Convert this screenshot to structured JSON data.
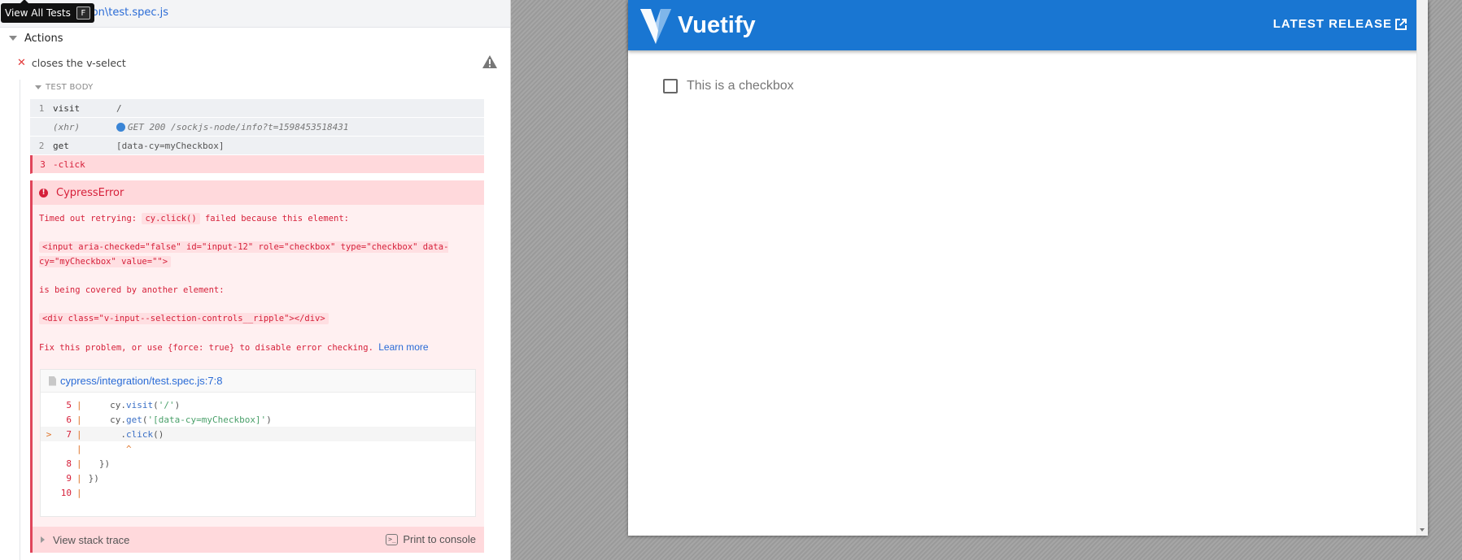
{
  "reporter": {
    "tooltip": {
      "label": "View All Tests",
      "shortcut": "F"
    },
    "spec_path": "tion\\test.spec.js",
    "suite_title": "Actions",
    "test_title": "closes the v-select",
    "test_body_label": "TEST BODY",
    "commands": [
      {
        "num": "1",
        "name": "visit",
        "message": "/"
      },
      {
        "num": "",
        "name": "(xhr)",
        "message": "GET 200 /sockjs-node/info?t=1598453518431"
      },
      {
        "num": "2",
        "name": "get",
        "message": "[data-cy=myCheckbox]"
      },
      {
        "num": "3",
        "name": "-click",
        "message": ""
      }
    ],
    "error": {
      "name": "CypressError",
      "line1_prefix": "Timed out retrying: ",
      "line1_code": "cy.click()",
      "line1_suffix": " failed because this element:",
      "element_html": "<input aria-checked=\"false\" id=\"input-12\" role=\"checkbox\" type=\"checkbox\" data-cy=\"myCheckbox\" value=\"\">",
      "covered_text": "is being covered by another element:",
      "covering_html": "<div class=\"v-input--selection-controls__ripple\"></div>",
      "fix_text": "Fix this problem, or use {force: true} to disable error checking.",
      "learn_more": "Learn more",
      "code_frame_file": "cypress/integration/test.spec.js:7:8",
      "code_lines": [
        {
          "arrow": "",
          "num": "5",
          "code": "cy.visit('/')"
        },
        {
          "arrow": "",
          "num": "6",
          "code": "cy.get('[data-cy=myCheckbox]')"
        },
        {
          "arrow": ">",
          "num": "7",
          "code": ".click()"
        },
        {
          "arrow": "",
          "num": "",
          "code": "^"
        },
        {
          "arrow": "",
          "num": "8",
          "code": "})"
        },
        {
          "arrow": "",
          "num": "9",
          "code": "})"
        },
        {
          "arrow": "",
          "num": "10",
          "code": ""
        }
      ],
      "stack_trace_label": "View stack trace",
      "print_label": "Print to console"
    }
  },
  "app": {
    "title": "Vuetify",
    "release_label": "LATEST RELEASE",
    "checkbox_label": "This is a checkbox",
    "brand_color": "#1976d2"
  }
}
